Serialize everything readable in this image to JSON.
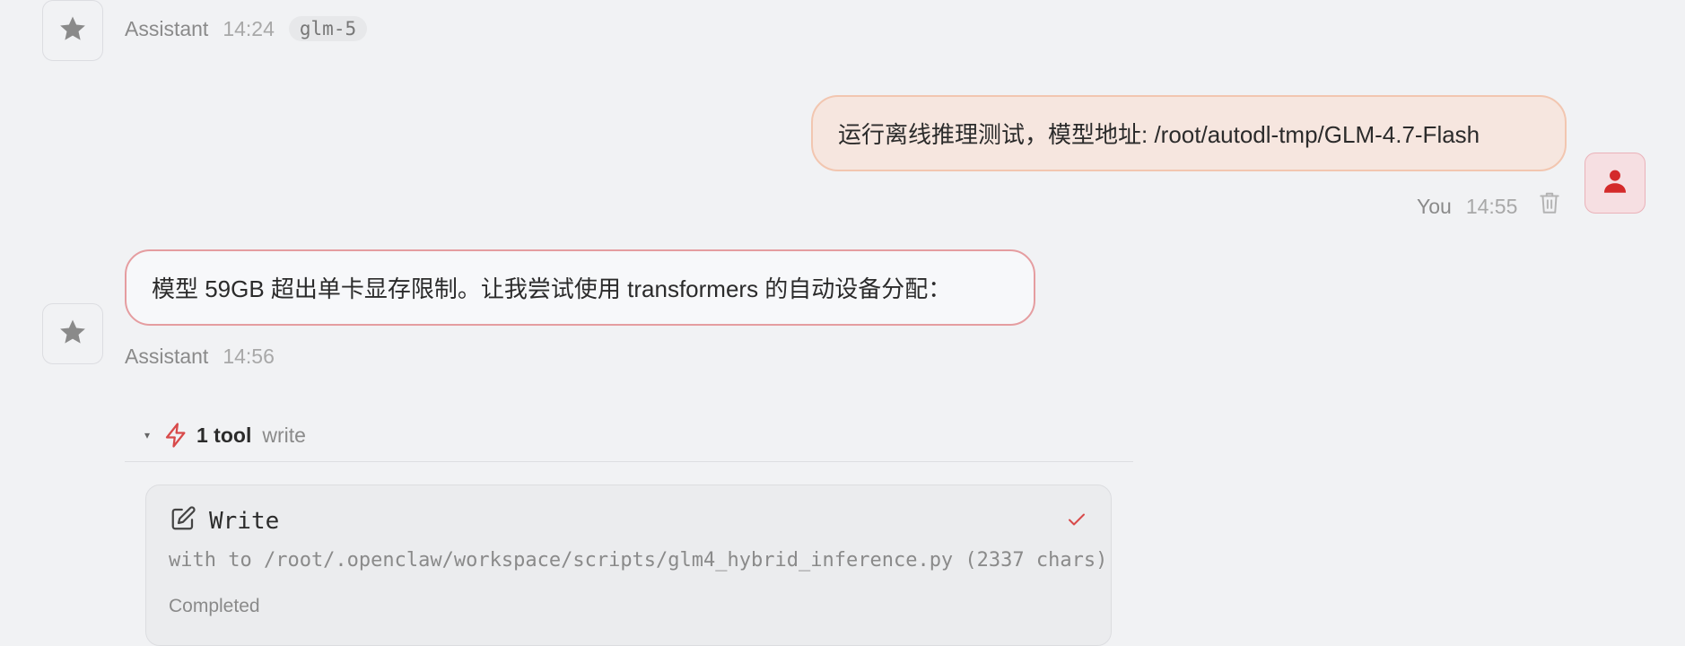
{
  "messages": [
    {
      "role": "assistant",
      "author": "Assistant",
      "time": "14:24",
      "model": "glm-5",
      "avatar_icon": "star-icon"
    },
    {
      "role": "user",
      "author": "You",
      "time": "14:55",
      "text": "运行离线推理测试，模型地址: /root/autodl-tmp/GLM-4.7-Flash",
      "avatar_icon": "user-icon",
      "action_icon": "trash-icon"
    },
    {
      "role": "assistant",
      "author": "Assistant",
      "time": "14:56",
      "text": "模型 59GB 超出单卡显存限制。让我尝试使用 transformers 的自动设备分配：",
      "avatar_icon": "star-icon"
    }
  ],
  "tools": {
    "caret_icon": "triangle-down-icon",
    "icon": "bolt-icon",
    "count_label": "1 tool",
    "name": "write",
    "card": {
      "icon": "edit-icon",
      "title": "Write",
      "status_icon": "check-icon",
      "description": "with to /root/.openclaw/workspace/scripts/glm4_hybrid_inference.py (2337 chars)",
      "status": "Completed"
    }
  },
  "colors": {
    "background": "#f1f2f4",
    "user_bubble": "#f6e6df",
    "user_bubble_border": "#f2c6b0",
    "assistant_bubble_border": "#e59da0",
    "accent_red": "#d84a4a"
  }
}
